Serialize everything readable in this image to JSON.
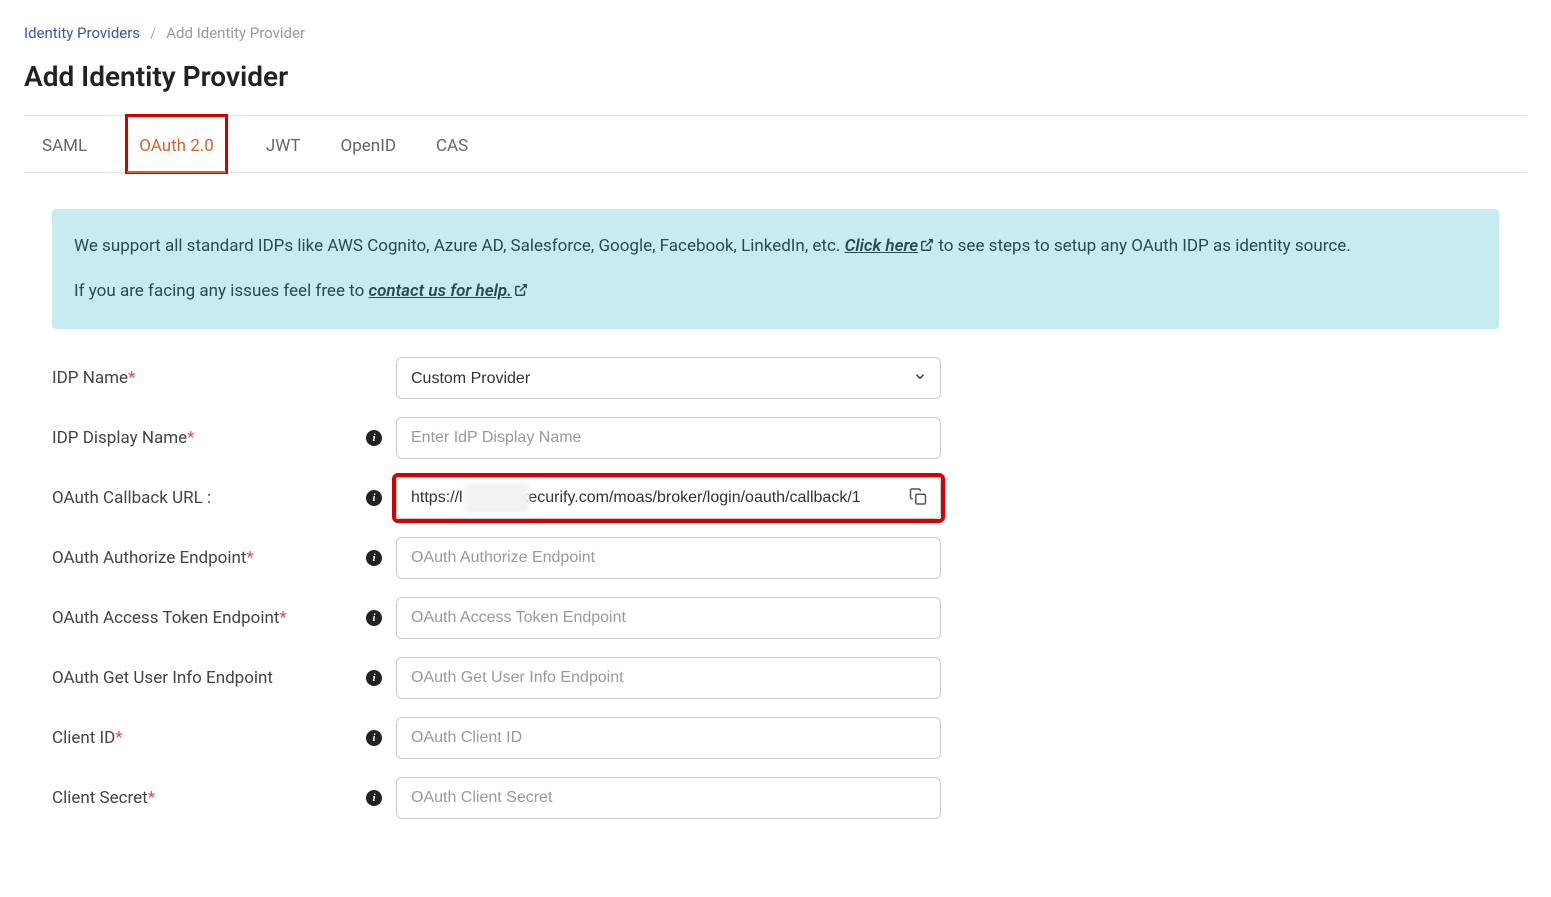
{
  "breadcrumb": {
    "root": "Identity Providers",
    "current": "Add Identity Provider"
  },
  "page_title": "Add Identity Provider",
  "tabs": [
    {
      "id": "saml",
      "label": "SAML",
      "active": false
    },
    {
      "id": "oauth",
      "label": "OAuth 2.0",
      "active": true
    },
    {
      "id": "jwt",
      "label": "JWT",
      "active": false
    },
    {
      "id": "openid",
      "label": "OpenID",
      "active": false
    },
    {
      "id": "cas",
      "label": "CAS",
      "active": false
    }
  ],
  "banner": {
    "line1_pre": "We support all standard IDPs like AWS Cognito, Azure AD, Salesforce, Google, Facebook, LinkedIn, etc. ",
    "link1": "Click here",
    "line1_post": " to see steps to setup any OAuth IDP as identity source.",
    "line2_pre": "If you are facing any issues feel free to ",
    "link2": "contact us for help."
  },
  "form": {
    "idp_name": {
      "label": "IDP Name",
      "selected": "Custom Provider"
    },
    "idp_display_name": {
      "label": "IDP Display Name",
      "placeholder": "Enter IdP Display Name",
      "value": ""
    },
    "callback_url": {
      "label": "OAuth Callback URL :",
      "value": "https://l            .xecurify.com/moas/broker/login/oauth/callback/1"
    },
    "authorize_ep": {
      "label": "OAuth Authorize Endpoint",
      "placeholder": "OAuth Authorize Endpoint",
      "value": ""
    },
    "token_ep": {
      "label": "OAuth Access Token Endpoint",
      "placeholder": "OAuth Access Token Endpoint",
      "value": ""
    },
    "userinfo_ep": {
      "label": "OAuth Get User Info Endpoint",
      "placeholder": "OAuth Get User Info Endpoint",
      "value": ""
    },
    "client_id": {
      "label": "Client ID",
      "placeholder": "OAuth Client ID",
      "value": ""
    },
    "client_secret": {
      "label": "Client Secret",
      "placeholder": "OAuth Client Secret",
      "value": ""
    }
  }
}
